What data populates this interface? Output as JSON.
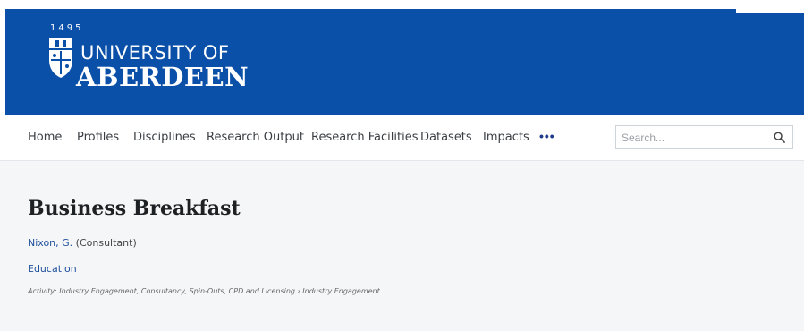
{
  "header": {
    "logo_year": "1495",
    "logo_line1": "UNIVERSITY OF",
    "logo_line2": "ABERDEEN",
    "brand_color": "#0a4fa8"
  },
  "nav": {
    "items": [
      {
        "label": "Home"
      },
      {
        "label": "Profiles"
      },
      {
        "label": "Disciplines"
      },
      {
        "label": "Research Output"
      },
      {
        "label": "Research Facilities"
      },
      {
        "label": "Datasets"
      },
      {
        "label": "Impacts"
      }
    ],
    "more_label": "•••",
    "more_icon": "more-dots-icon"
  },
  "search": {
    "placeholder": "Search...",
    "value": "",
    "icon": "search-icon"
  },
  "activity": {
    "title": "Business Breakfast",
    "person_name": "Nixon, G.",
    "person_role": " (Consultant)",
    "category": "Education",
    "type_line": "Activity: Industry Engagement, Consultancy, Spin-Outs, CPD and Licensing › Industry Engagement"
  }
}
